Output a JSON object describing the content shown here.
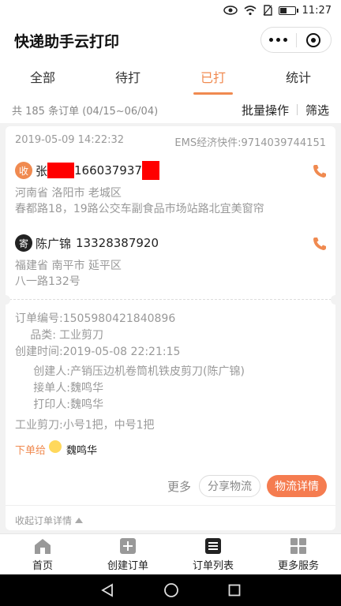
{
  "status_bar": {
    "time": "11:27"
  },
  "app": {
    "title": "快递助手云打印"
  },
  "tabs": [
    {
      "label": "全部"
    },
    {
      "label": "待打"
    },
    {
      "label": "已打"
    },
    {
      "label": "统计"
    }
  ],
  "summary": {
    "count_text": "共 185 条订单 (04/15~06/04)",
    "batch_label": "批量操作",
    "filter_label": "筛选"
  },
  "order": {
    "datetime": "2019-05-09 14:22:32",
    "waybill": "EMS经济快件:9714039744151",
    "sender": {
      "badge": "收",
      "name": "张",
      "phone": "166037937",
      "region": "河南省 洛阳市 老城区",
      "street": "春都路18，19路公交车副食品市场站路北宜美窗帘"
    },
    "receiver": {
      "badge": "寄",
      "name": "陈广锦",
      "phone": "13328387920",
      "region": "福建省 南平市 延平区",
      "street": "八一路132号"
    },
    "details": {
      "order_no_label": "订单编号:",
      "order_no": "1505980421840896",
      "category_label": "品类:",
      "category": "工业剪刀",
      "created_label": "创建时间:",
      "created": "2019-05-08 22:21:15",
      "creator_label": "创建人:",
      "creator": "产销压边机卷筒机铁皮剪刀(陈广锦)",
      "taker_label": "接单人:",
      "taker": "魏鸣华",
      "printer_label": "打印人:",
      "printer": "魏鸣华",
      "items": "工业剪刀:小号1把，中号1把",
      "assign_label": "下单给",
      "assign_to": "魏鸣华"
    },
    "actions": {
      "more": "更多",
      "share": "分享物流",
      "logistics": "物流详情"
    },
    "collapse_label": "收起订单详情"
  },
  "bottom_nav": [
    {
      "label": "首页",
      "icon": "home-icon"
    },
    {
      "label": "创建订单",
      "icon": "plus-icon"
    },
    {
      "label": "订单列表",
      "icon": "list-icon"
    },
    {
      "label": "更多服务",
      "icon": "grid-icon"
    }
  ],
  "colors": {
    "accent": "#f08a50",
    "button": "#f57c50",
    "redaction": "#ff0000"
  }
}
